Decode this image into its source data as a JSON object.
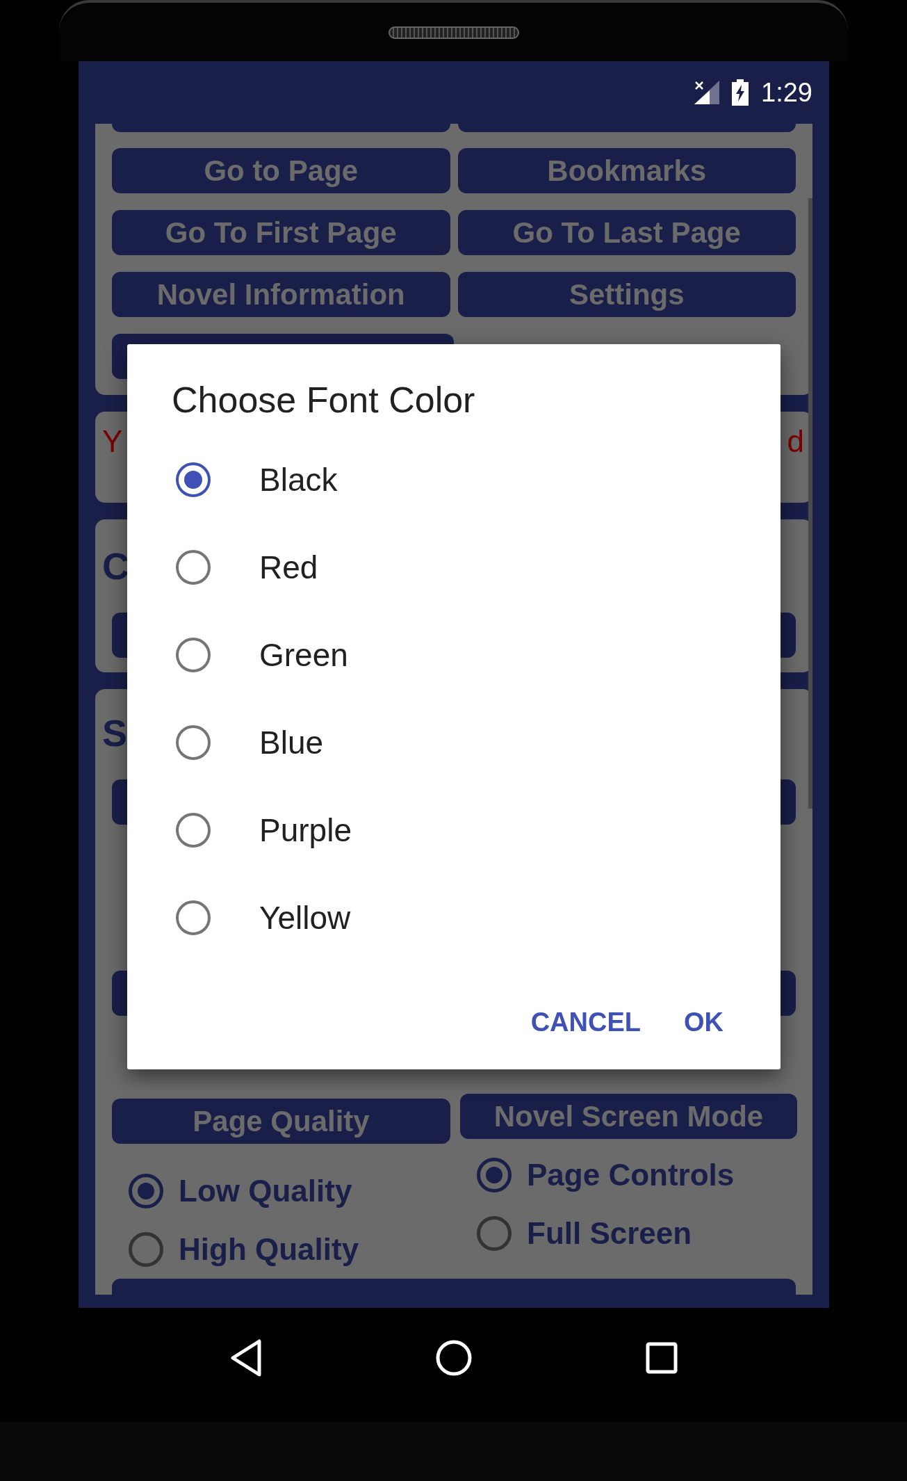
{
  "status_bar": {
    "time": "1:29"
  },
  "menu_buttons": [
    "Go to Page",
    "Bookmarks",
    "Go To First Page",
    "Go To Last Page",
    "Novel Information",
    "Settings"
  ],
  "notice": {
    "left_fragment": "Y",
    "right_fragment": "d"
  },
  "section_fragments": [
    "C",
    "S"
  ],
  "page_quality": {
    "title": "Page Quality",
    "options": [
      {
        "label": "Low Quality",
        "selected": true
      },
      {
        "label": "High Quality",
        "selected": false
      }
    ]
  },
  "screen_mode": {
    "title": "Novel Screen Mode",
    "options": [
      {
        "label": "Page Controls",
        "selected": true
      },
      {
        "label": "Full Screen",
        "selected": false
      }
    ]
  },
  "dialog": {
    "title": "Choose Font Color",
    "options": [
      {
        "label": "Black",
        "selected": true
      },
      {
        "label": "Red",
        "selected": false
      },
      {
        "label": "Green",
        "selected": false
      },
      {
        "label": "Blue",
        "selected": false
      },
      {
        "label": "Purple",
        "selected": false
      },
      {
        "label": "Yellow",
        "selected": false
      }
    ],
    "buttons": [
      "CANCEL",
      "OK"
    ]
  }
}
